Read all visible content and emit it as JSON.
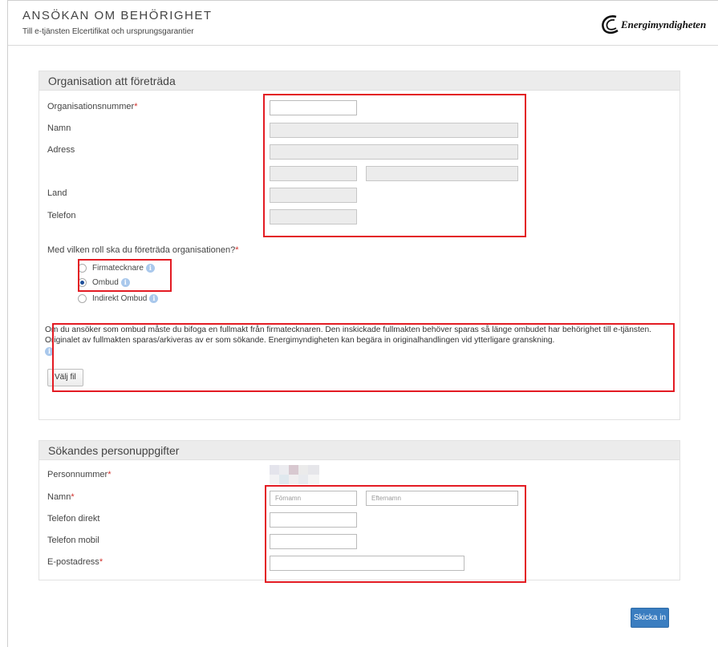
{
  "header": {
    "title": "ANSÖKAN OM BEHÖRIGHET",
    "subtitle": "Till e-tjänsten Elcertifikat och ursprungsgarantier",
    "logo_text": "Energimyndigheten"
  },
  "organisation": {
    "heading": "Organisation att företräda",
    "org_number_label": "Organisationsnummer",
    "name_label": "Namn",
    "address_label": "Adress",
    "country_label": "Land",
    "phone_label": "Telefon",
    "role_question": "Med vilken roll ska du företräda organisationen?",
    "roles": [
      "Firmatecknare",
      "Ombud",
      "Indirekt Ombud"
    ],
    "selected_role": "Ombud",
    "notice": "Om du ansöker som ombud måste du bifoga en fullmakt från firmatecknaren. Den inskickade fullmakten behöver sparas så länge ombudet har behörighet till e-tjänsten. Originalet av fullmakten sparas/arkiveras av er som sökande. Energimyndigheten kan begära in originalhandlingen vid ytterligare granskning.",
    "file_button": "Välj fil"
  },
  "applicant": {
    "heading": "Sökandes personuppgifter",
    "personal_number_label": "Personnummer",
    "name_label": "Namn",
    "first_name_placeholder": "Förnamn",
    "last_name_placeholder": "Efternamn",
    "phone_direct_label": "Telefon direkt",
    "phone_mobile_label": "Telefon mobil",
    "email_label": "E-postadress"
  },
  "required_marker": "*",
  "info_glyph": "i",
  "submit_label": "Skicka in",
  "colors": {
    "accent": "#3a7dc0",
    "highlight": "#e31b23",
    "required": "#d2322d"
  }
}
